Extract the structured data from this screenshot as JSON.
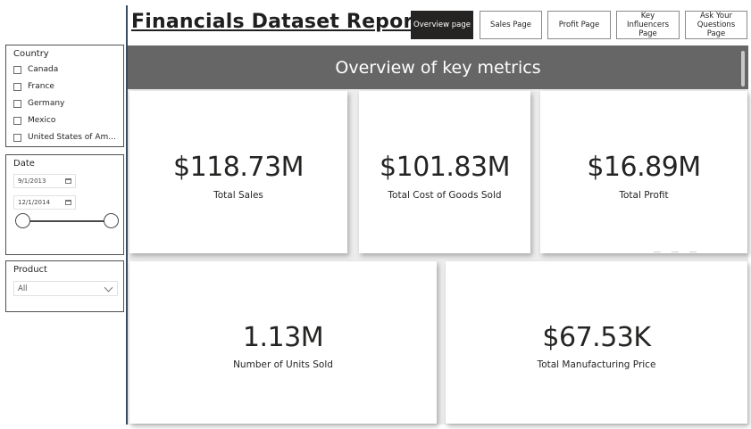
{
  "report": {
    "title": "Financials Dataset Report"
  },
  "nav": [
    {
      "label": "Overview page",
      "active": true
    },
    {
      "label": "Sales Page",
      "active": false
    },
    {
      "label": "Profit Page",
      "active": false
    },
    {
      "label": "Key Influencers Page",
      "active": false
    },
    {
      "label": "Ask Your Questions Page",
      "active": false
    }
  ],
  "slicers": {
    "country": {
      "title": "Country",
      "items": [
        "Canada",
        "France",
        "Germany",
        "Mexico",
        "United States of Am..."
      ]
    },
    "date": {
      "title": "Date",
      "start": "9/1/2013",
      "end": "12/1/2014"
    },
    "product": {
      "title": "Product",
      "selected": "All"
    }
  },
  "banner": {
    "text": "Overview of key metrics"
  },
  "cards": [
    {
      "value": "$118.73M",
      "label": "Total Sales"
    },
    {
      "value": "$101.83M",
      "label": "Total Cost of Goods Sold"
    },
    {
      "value": "$16.89M",
      "label": "Total Profit"
    },
    {
      "value": "1.13M",
      "label": "Number of Units Sold"
    },
    {
      "value": "$67.53K",
      "label": "Total Manufacturing Price"
    }
  ],
  "colors": {
    "banner_bg": "#666666",
    "active_nav": "#252423",
    "divider": "#3a4c63"
  }
}
